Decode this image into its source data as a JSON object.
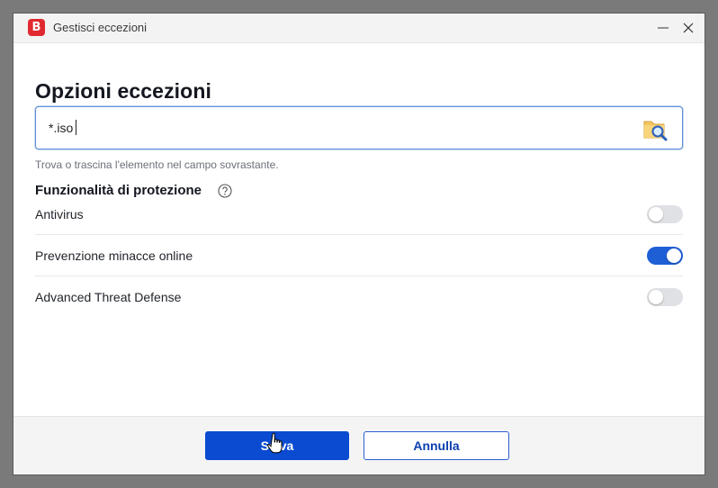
{
  "window": {
    "title": "Gestisci eccezioni",
    "logo_letter": "B"
  },
  "page": {
    "heading": "Opzioni eccezioni"
  },
  "path_field": {
    "value": "*.iso",
    "hint": "Trova o trascina l'elemento nel campo sovrastante."
  },
  "protection": {
    "title": "Funzionalità di protezione",
    "features": [
      {
        "label": "Antivirus",
        "enabled": false
      },
      {
        "label": "Prevenzione minacce online",
        "enabled": true
      },
      {
        "label": "Advanced Threat Defense",
        "enabled": false
      }
    ]
  },
  "footer": {
    "save_label": "Salva",
    "cancel_label": "Annulla"
  },
  "colors": {
    "accent": "#0a4bd1",
    "toggle_on": "#1f5fd6",
    "toggle_off": "#e0e1e4",
    "brand": "#e02a2f"
  },
  "icons": {
    "app": "bitdefender-logo-icon",
    "browse": "folder-search-icon",
    "help": "question-circle-icon",
    "minimize": "minimize-icon",
    "close": "close-icon"
  }
}
